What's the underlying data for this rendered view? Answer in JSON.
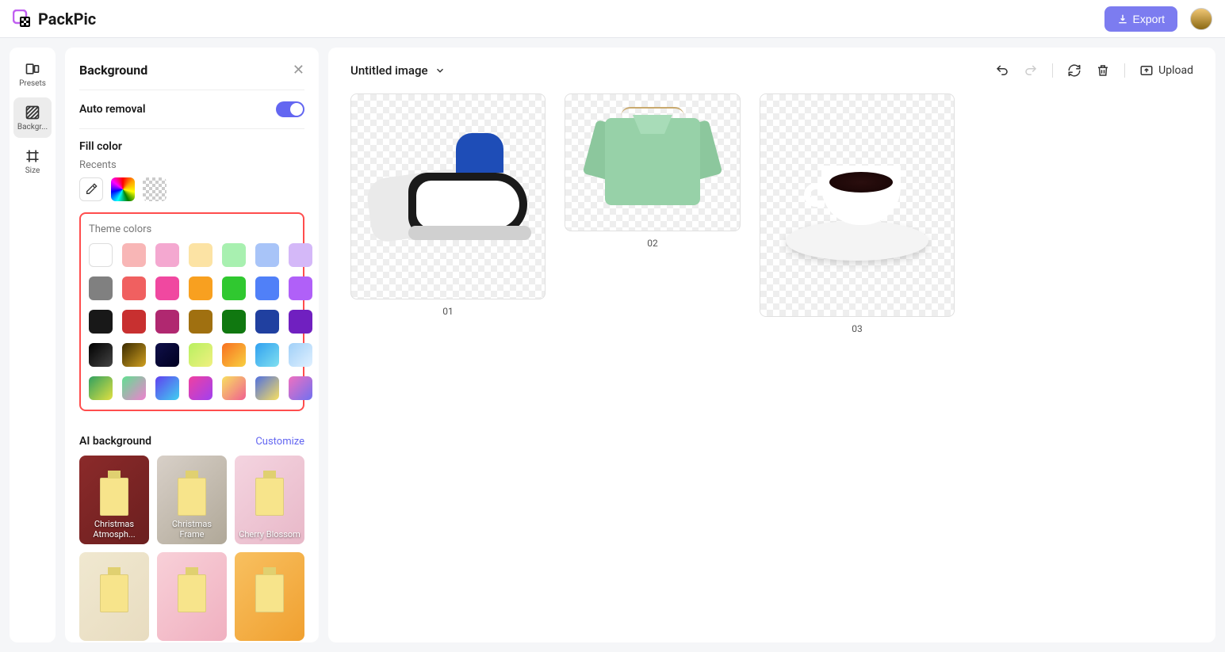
{
  "app": {
    "name": "PackPic"
  },
  "topbar": {
    "export_label": "Export"
  },
  "vtabs": {
    "presets": "Presets",
    "background": "Backgr...",
    "size": "Size"
  },
  "panel": {
    "title": "Background",
    "auto_removal": "Auto removal",
    "fill_color": "Fill color",
    "recents": "Recents",
    "theme_colors": "Theme colors",
    "ai_background": "AI background",
    "customize": "Customize"
  },
  "theme_colors": [
    "#ffffff",
    "#f8b6b6",
    "#f4a8d0",
    "#fce3a4",
    "#a8f0b0",
    "#a8c4f8",
    "#d4b8f8",
    "#808080",
    "#f06060",
    "#f048a0",
    "#f8a020",
    "#30c830",
    "#5080f8",
    "#b060f8",
    "#181818",
    "#c83030",
    "#b02870",
    "#a07010",
    "#107810",
    "#2040a0",
    "#7020c0"
  ],
  "theme_gradients": [
    "linear-gradient(135deg,#000,#444)",
    "linear-gradient(135deg,#3a2a00,#d0a020)",
    "linear-gradient(135deg,#10104a,#000020)",
    "linear-gradient(135deg,#b8f060,#f0f080)",
    "linear-gradient(135deg,#f87020,#f8d040)",
    "linear-gradient(135deg,#30a0f0,#80e0f0)",
    "linear-gradient(135deg,#a0d0f8,#e0f0ff)",
    "linear-gradient(135deg,#30a060,#e0e040)",
    "linear-gradient(135deg,#60e090,#f080d0)",
    "linear-gradient(135deg,#6040f0,#40d0f0)",
    "linear-gradient(135deg,#f040a0,#a040f0)",
    "linear-gradient(135deg,#f8e060,#f06090)",
    "linear-gradient(135deg,#5070e0,#f8e060)",
    "linear-gradient(135deg,#f070c0,#7070f0)"
  ],
  "ai_bgs": [
    {
      "label": "Christmas Atmosph...",
      "bg": "linear-gradient(135deg,#8b2a2a,#6b1f1f)"
    },
    {
      "label": "Christmas Frame",
      "bg": "linear-gradient(135deg,#d8d0c8,#b0a898)"
    },
    {
      "label": "Cherry Blossom",
      "bg": "linear-gradient(135deg,#f4d4e0,#e8b8c8)"
    },
    {
      "label": "",
      "bg": "linear-gradient(135deg,#f0e8d0,#e8dcc0)"
    },
    {
      "label": "",
      "bg": "linear-gradient(135deg,#f8d0d8,#f0b0c0)"
    },
    {
      "label": "",
      "bg": "linear-gradient(135deg,#f8c060,#f0a030)"
    }
  ],
  "canvas": {
    "title": "Untitled image",
    "upload": "Upload",
    "images": [
      {
        "caption": "01"
      },
      {
        "caption": "02"
      },
      {
        "caption": "03"
      }
    ]
  }
}
